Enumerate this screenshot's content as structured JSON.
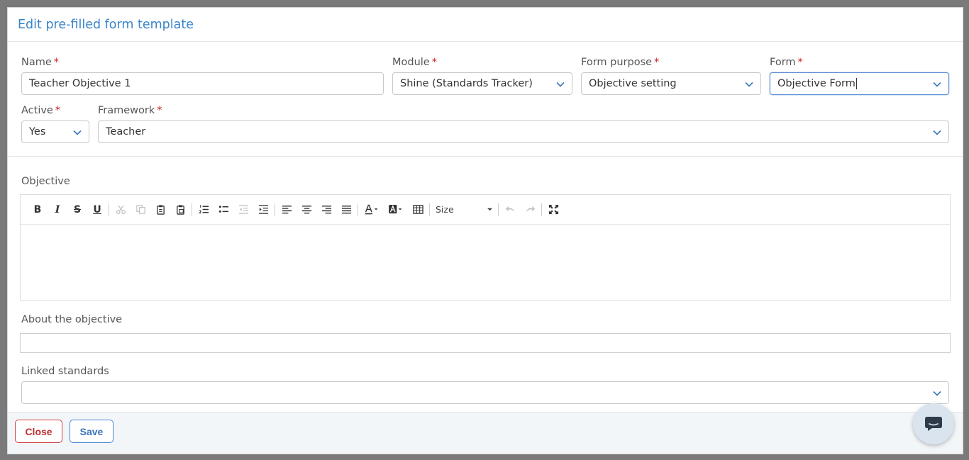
{
  "modal": {
    "title": "Edit pre-filled form template"
  },
  "fields": {
    "name": {
      "label": "Name",
      "required": "*",
      "value": "Teacher Objective 1"
    },
    "module": {
      "label": "Module",
      "required": "*",
      "value": "Shine (Standards Tracker)"
    },
    "form_purpose": {
      "label": "Form purpose",
      "required": "*",
      "value": "Objective setting"
    },
    "form": {
      "label": "Form",
      "required": "*",
      "value": "Objective Form"
    },
    "active": {
      "label": "Active",
      "required": "*",
      "value": "Yes"
    },
    "framework": {
      "label": "Framework",
      "required": "*",
      "value": "Teacher"
    }
  },
  "objective": {
    "label": "Objective",
    "toolbar": {
      "icons": [
        "bold-icon",
        "italic-icon",
        "strikethrough-icon",
        "underline-icon",
        "cut-icon",
        "copy-icon",
        "paste-icon",
        "paste-from-word-icon",
        "numbered-list-icon",
        "bulleted-list-icon",
        "outdent-icon",
        "indent-icon",
        "align-left-icon",
        "align-center-icon",
        "align-right-icon",
        "justify-icon",
        "text-color-icon",
        "background-color-icon",
        "table-icon",
        "undo-icon",
        "redo-icon",
        "maximize-icon"
      ],
      "size_label": "Size"
    },
    "content": ""
  },
  "about": {
    "label": "About the objective",
    "value": ""
  },
  "linked_standards": {
    "label": "Linked standards",
    "value": ""
  },
  "footer": {
    "close_label": "Close",
    "save_label": "Save"
  },
  "colors": {
    "title": "#3a85c9",
    "required": "#cc2222",
    "close_button": "#c23030",
    "save_button": "#3a74ba",
    "focus_border": "#5c8fd6"
  },
  "chat_widget": {
    "icon": "chat-icon"
  }
}
